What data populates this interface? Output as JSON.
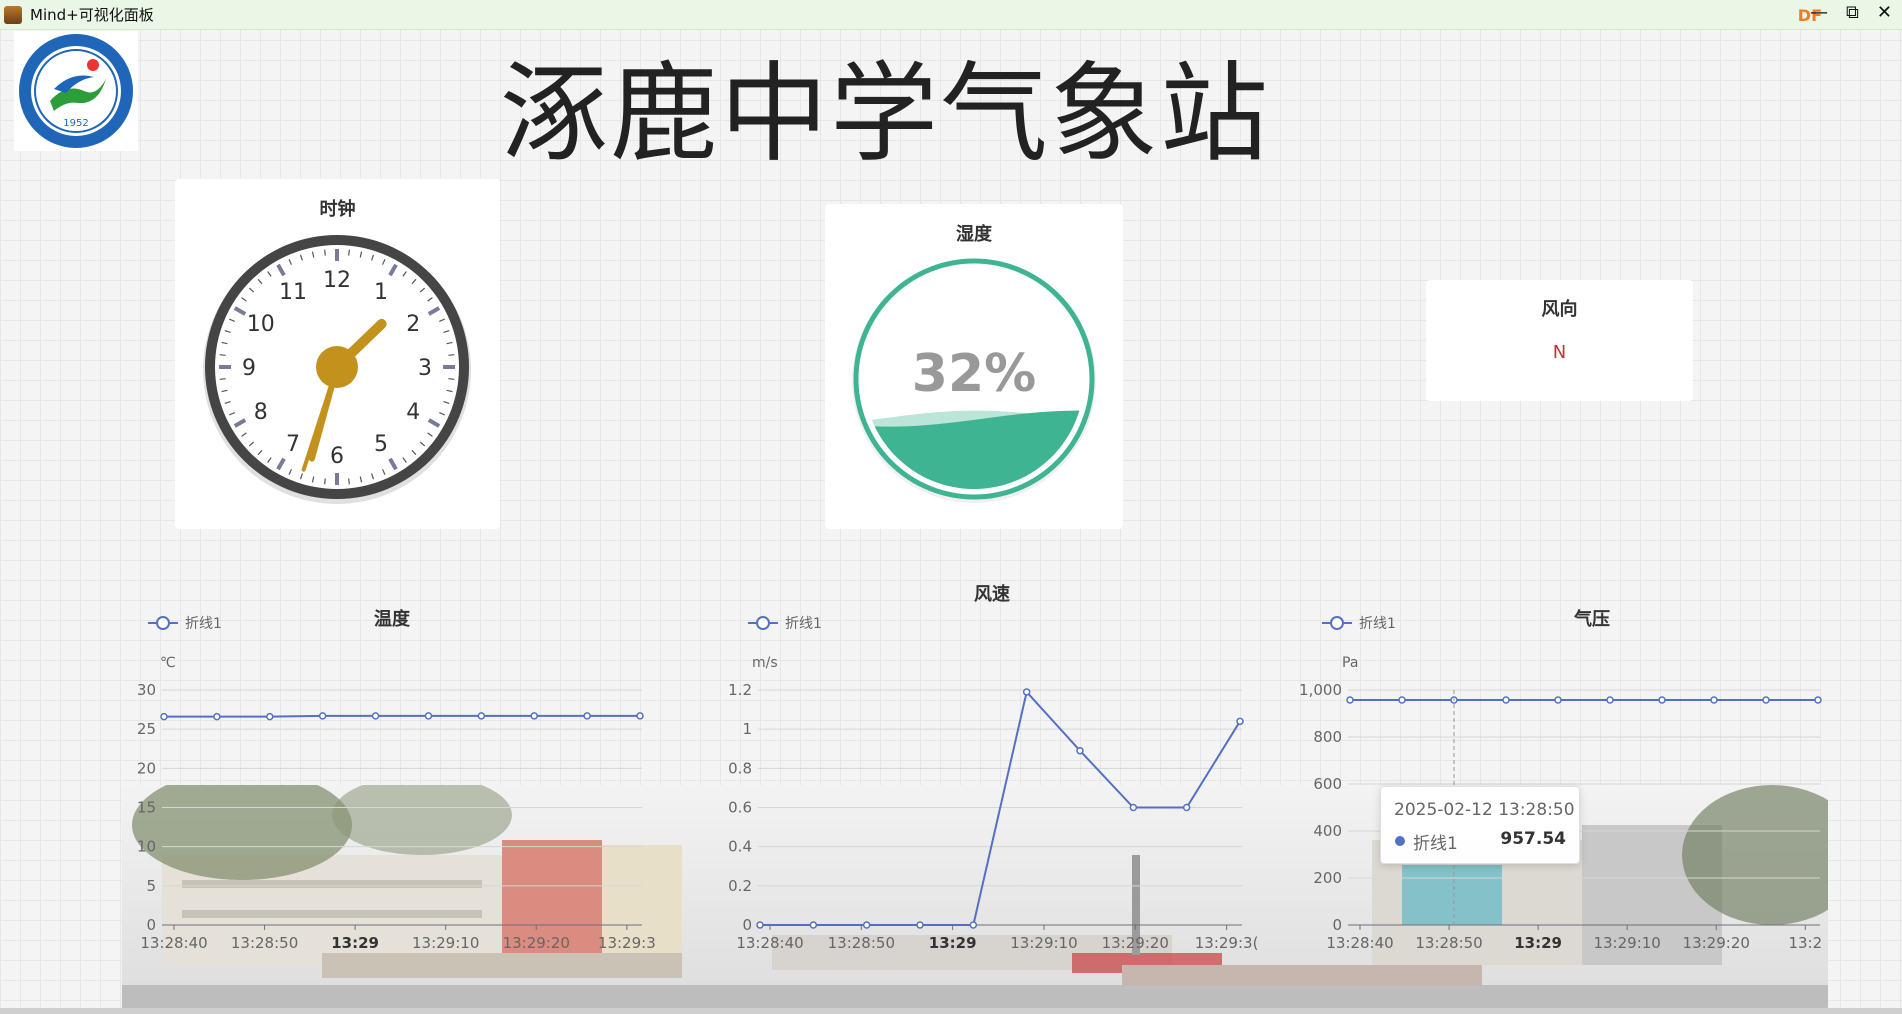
{
  "window": {
    "title": "Mind+可视化面板",
    "badge": "DF",
    "controls": [
      "—",
      "⧉",
      "✕"
    ]
  },
  "header": {
    "title": "涿鹿中学气象站"
  },
  "logo": {
    "year": "1952"
  },
  "clock": {
    "title": "时钟",
    "hour": 1,
    "minute": 32,
    "second": 33,
    "numbers": [
      "12",
      "1",
      "2",
      "3",
      "4",
      "5",
      "6",
      "7",
      "8",
      "9",
      "10",
      "11"
    ]
  },
  "humidity": {
    "title": "湿度",
    "value": 32,
    "label": "32%",
    "color": "#3fb492"
  },
  "wind_direction": {
    "title": "风向",
    "value": "N",
    "color": "#c23531"
  },
  "tooltip": {
    "time": "2025-02-12 13:28:50",
    "series": "折线1",
    "value": "957.54"
  },
  "chart_data": [
    {
      "type": "line",
      "title": "温度",
      "ylabel": "℃",
      "legend": "折线1",
      "xticks": [
        "13:28:40",
        "13:28:50",
        "13:29",
        "13:29:10",
        "13:29:20",
        "13:29:3"
      ],
      "yticks": [
        "0",
        "5",
        "10",
        "15",
        "20",
        "25",
        "30"
      ],
      "ylim": [
        0,
        30
      ],
      "series": [
        {
          "name": "折线1",
          "values": [
            26.6,
            26.6,
            26.6,
            26.7,
            26.7,
            26.7,
            26.7,
            26.7,
            26.7,
            26.7
          ]
        }
      ],
      "color": "#5470c6"
    },
    {
      "type": "line",
      "title": "风速",
      "ylabel": "m/s",
      "legend": "折线1",
      "xticks": [
        "13:28:40",
        "13:28:50",
        "13:29",
        "13:29:10",
        "13:29:20",
        "13:29:3("
      ],
      "yticks": [
        "0",
        "0.2",
        "0.4",
        "0.6",
        "0.8",
        "1",
        "1.2"
      ],
      "ylim": [
        0,
        1.2
      ],
      "series": [
        {
          "name": "折线1",
          "values": [
            0,
            0,
            0,
            0,
            0,
            1.19,
            0.89,
            0.6,
            0.6,
            1.04
          ]
        }
      ],
      "color": "#5470c6"
    },
    {
      "type": "line",
      "title": "气压",
      "ylabel": "Pa",
      "legend": "折线1",
      "xticks": [
        "13:28:40",
        "13:28:50",
        "13:29",
        "13:29:10",
        "13:29:20",
        "13:2"
      ],
      "yticks": [
        "0",
        "200",
        "400",
        "600",
        "800",
        "1,000"
      ],
      "ylim": [
        0,
        1000
      ],
      "series": [
        {
          "name": "折线1",
          "values": [
            957.5,
            957.5,
            957.54,
            957.5,
            957.5,
            957.5,
            957.5,
            957.5,
            957.5,
            957.5
          ]
        }
      ],
      "color": "#5470c6"
    }
  ]
}
